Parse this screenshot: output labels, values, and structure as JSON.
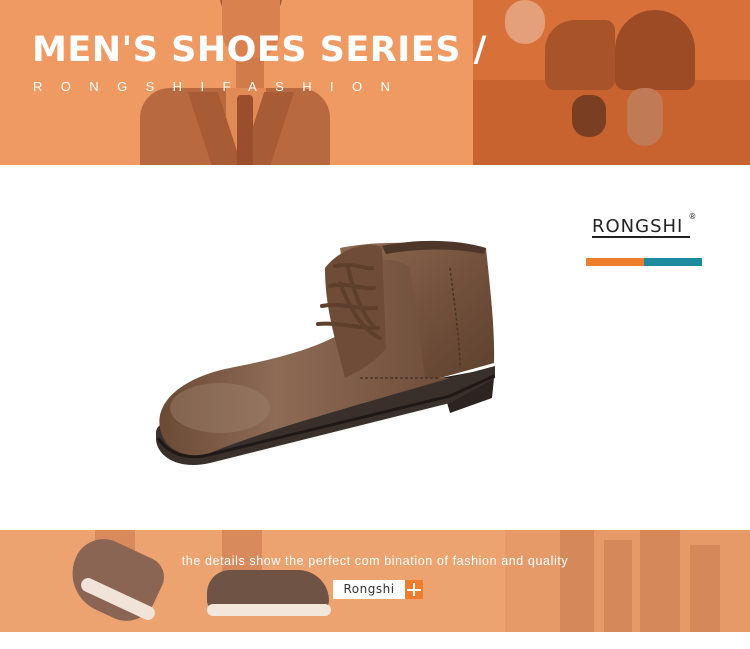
{
  "header": {
    "title": "MEN'S SHOES SERIES /",
    "subtitle": "RONGSHIFASHION"
  },
  "brand": {
    "logo_text": "RONGSHI",
    "registered_mark": "R"
  },
  "product": {
    "image": "brown-leather-chukka-boot"
  },
  "footer": {
    "tagline": "the details show the perfect com bination of fashion and quality",
    "chip_label": "Rongshi",
    "chip_icon": "plus-icon"
  },
  "colors": {
    "banner_orange": "#ef9a63",
    "accent_orange": "#ef7d2e",
    "accent_teal": "#1d8aa0"
  }
}
